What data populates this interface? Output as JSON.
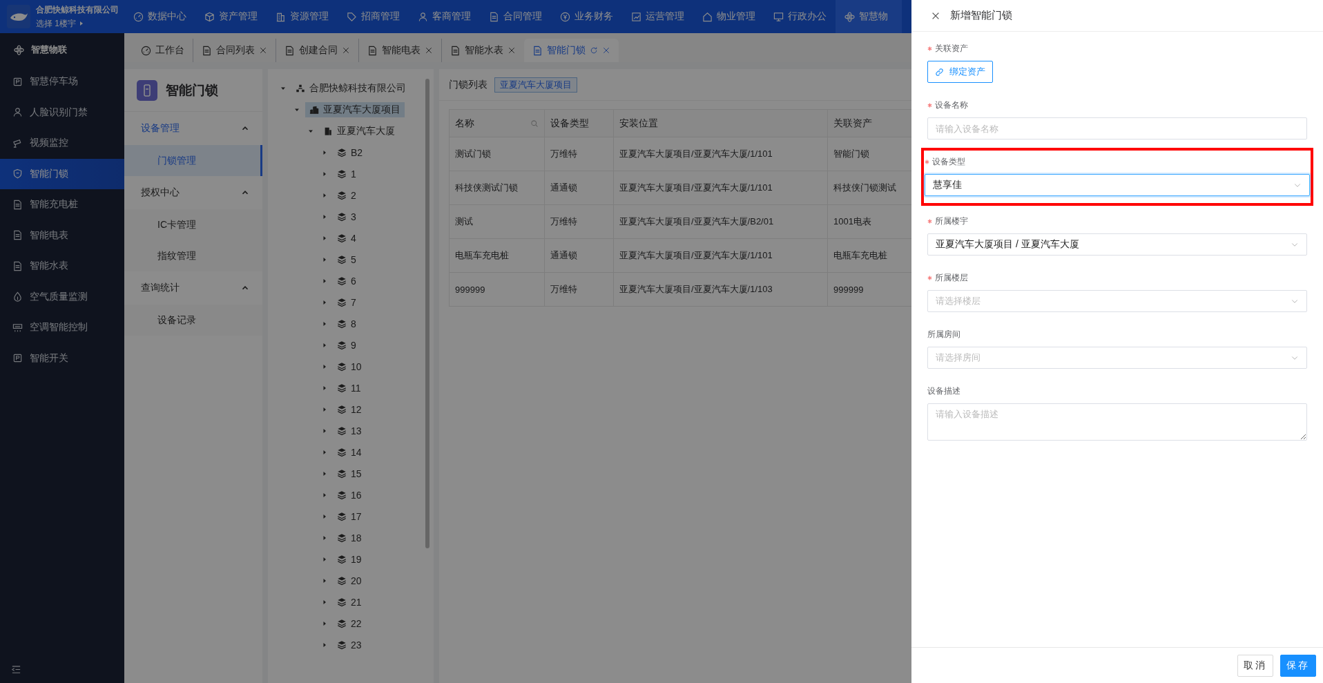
{
  "top_bar": {
    "company": "合肥快鲸科技有限公司",
    "building_picker": "选择 1楼宇",
    "nav": [
      {
        "label": "数据中心",
        "selected": false
      },
      {
        "label": "资产管理",
        "selected": false
      },
      {
        "label": "资源管理",
        "selected": false
      },
      {
        "label": "招商管理",
        "selected": false
      },
      {
        "label": "客商管理",
        "selected": false
      },
      {
        "label": "合同管理",
        "selected": false
      },
      {
        "label": "业务财务",
        "selected": false
      },
      {
        "label": "运营管理",
        "selected": false
      },
      {
        "label": "物业管理",
        "selected": false
      },
      {
        "label": "行政办公",
        "selected": false
      },
      {
        "label": "智慧物",
        "selected": true
      }
    ]
  },
  "sidebar": {
    "title": "智慧物联",
    "items": [
      {
        "label": "智慧停车场",
        "selected": false
      },
      {
        "label": "人脸识别门禁",
        "selected": false
      },
      {
        "label": "视频监控",
        "selected": false
      },
      {
        "label": "智能门锁",
        "selected": true
      },
      {
        "label": "智能充电桩",
        "selected": false
      },
      {
        "label": "智能电表",
        "selected": false
      },
      {
        "label": "智能水表",
        "selected": false
      },
      {
        "label": "空气质量监测",
        "selected": false
      },
      {
        "label": "空调智能控制",
        "selected": false
      },
      {
        "label": "智能开关",
        "selected": false
      }
    ]
  },
  "tabs": [
    {
      "label": "工作台",
      "selected": false,
      "closable": false
    },
    {
      "label": "合同列表",
      "selected": false,
      "closable": true
    },
    {
      "label": "创建合同",
      "selected": false,
      "closable": true
    },
    {
      "label": "智能电表",
      "selected": false,
      "closable": true
    },
    {
      "label": "智能水表",
      "selected": false,
      "closable": true
    },
    {
      "label": "智能门锁",
      "selected": true,
      "closable": true
    }
  ],
  "submenu": {
    "title": "智能门锁",
    "groups": [
      {
        "label": "设备管理",
        "expanded": true,
        "active": true,
        "items": [
          {
            "label": "门锁管理",
            "selected": true
          }
        ]
      },
      {
        "label": "授权中心",
        "expanded": true,
        "active": false,
        "items": [
          {
            "label": "IC卡管理",
            "selected": false
          },
          {
            "label": "指纹管理",
            "selected": false
          }
        ]
      },
      {
        "label": "查询统计",
        "expanded": true,
        "active": false,
        "items": [
          {
            "label": "设备记录",
            "selected": false
          }
        ]
      }
    ]
  },
  "tree": [
    {
      "label": "合肥快鲸科技有限公司",
      "kind": "company",
      "expanded": true,
      "selected": false,
      "children": [
        {
          "label": "亚夏汽车大厦项目",
          "kind": "project",
          "expanded": true,
          "selected": true,
          "children": [
            {
              "label": "亚夏汽车大厦",
              "kind": "building",
              "expanded": true,
              "selected": false,
              "children": [
                {
                  "label": "B2",
                  "kind": "floor",
                  "expanded": false,
                  "selected": false
                },
                {
                  "label": "1",
                  "kind": "floor",
                  "expanded": false,
                  "selected": false
                },
                {
                  "label": "2",
                  "kind": "floor",
                  "expanded": false,
                  "selected": false
                },
                {
                  "label": "3",
                  "kind": "floor",
                  "expanded": false,
                  "selected": false
                },
                {
                  "label": "4",
                  "kind": "floor",
                  "expanded": false,
                  "selected": false
                },
                {
                  "label": "5",
                  "kind": "floor",
                  "expanded": false,
                  "selected": false
                },
                {
                  "label": "6",
                  "kind": "floor",
                  "expanded": false,
                  "selected": false
                },
                {
                  "label": "7",
                  "kind": "floor",
                  "expanded": false,
                  "selected": false
                },
                {
                  "label": "8",
                  "kind": "floor",
                  "expanded": false,
                  "selected": false
                },
                {
                  "label": "9",
                  "kind": "floor",
                  "expanded": false,
                  "selected": false
                },
                {
                  "label": "10",
                  "kind": "floor",
                  "expanded": false,
                  "selected": false
                },
                {
                  "label": "11",
                  "kind": "floor",
                  "expanded": false,
                  "selected": false
                },
                {
                  "label": "12",
                  "kind": "floor",
                  "expanded": false,
                  "selected": false
                },
                {
                  "label": "13",
                  "kind": "floor",
                  "expanded": false,
                  "selected": false
                },
                {
                  "label": "14",
                  "kind": "floor",
                  "expanded": false,
                  "selected": false
                },
                {
                  "label": "15",
                  "kind": "floor",
                  "expanded": false,
                  "selected": false
                },
                {
                  "label": "16",
                  "kind": "floor",
                  "expanded": false,
                  "selected": false
                },
                {
                  "label": "17",
                  "kind": "floor",
                  "expanded": false,
                  "selected": false
                },
                {
                  "label": "18",
                  "kind": "floor",
                  "expanded": false,
                  "selected": false
                },
                {
                  "label": "19",
                  "kind": "floor",
                  "expanded": false,
                  "selected": false
                },
                {
                  "label": "20",
                  "kind": "floor",
                  "expanded": false,
                  "selected": false
                },
                {
                  "label": "21",
                  "kind": "floor",
                  "expanded": false,
                  "selected": false
                },
                {
                  "label": "22",
                  "kind": "floor",
                  "expanded": false,
                  "selected": false
                },
                {
                  "label": "23",
                  "kind": "floor",
                  "expanded": false,
                  "selected": false
                }
              ]
            }
          ]
        }
      ]
    }
  ],
  "lock_list": {
    "title": "门锁列表",
    "tag": "亚夏汽车大厦项目",
    "columns": [
      {
        "label": "名称",
        "searchable": true
      },
      {
        "label": "设备类型",
        "searchable": false
      },
      {
        "label": "安装位置",
        "searchable": false
      },
      {
        "label": "关联资产",
        "searchable": false
      }
    ],
    "rows": [
      [
        "测试门锁",
        "万维特",
        "亚夏汽车大厦项目/亚夏汽车大厦/1/101",
        "智能门锁"
      ],
      [
        "科技侠测试门锁",
        "通通锁",
        "亚夏汽车大厦项目/亚夏汽车大厦/1/101",
        "科技侠门锁测试"
      ],
      [
        "测试",
        "万维特",
        "亚夏汽车大厦项目/亚夏汽车大厦/B2/01",
        "1001电表"
      ],
      [
        "电瓶车充电桩",
        "通通锁",
        "亚夏汽车大厦项目/亚夏汽车大厦/1/101",
        "电瓶车充电桩"
      ],
      [
        "999999",
        "万维特",
        "亚夏汽车大厦项目/亚夏汽车大厦/1/103",
        "999999"
      ]
    ]
  },
  "drawer": {
    "title": "新增智能门锁",
    "fields": [
      {
        "kind": "button",
        "label": "关联资产",
        "required": true,
        "button": "绑定资产"
      },
      {
        "kind": "input",
        "label": "设备名称",
        "required": true,
        "placeholder": "请输入设备名称"
      },
      {
        "kind": "select",
        "label": "设备类型",
        "required": true,
        "value": "慧享佳",
        "focused": true,
        "highlighted": true
      },
      {
        "kind": "select",
        "label": "所属楼宇",
        "required": true,
        "value": "亚夏汽车大厦项目 / 亚夏汽车大厦"
      },
      {
        "kind": "select",
        "label": "所属楼层",
        "required": true,
        "placeholder": "请选择楼层"
      },
      {
        "kind": "select",
        "label": "所属房间",
        "required": false,
        "placeholder": "请选择房间"
      },
      {
        "kind": "textarea",
        "label": "设备描述",
        "required": false,
        "placeholder": "请输入设备描述"
      }
    ],
    "buttons": [
      {
        "label": "取消",
        "kind": "default"
      },
      {
        "label": "保存",
        "kind": "primary"
      }
    ]
  }
}
